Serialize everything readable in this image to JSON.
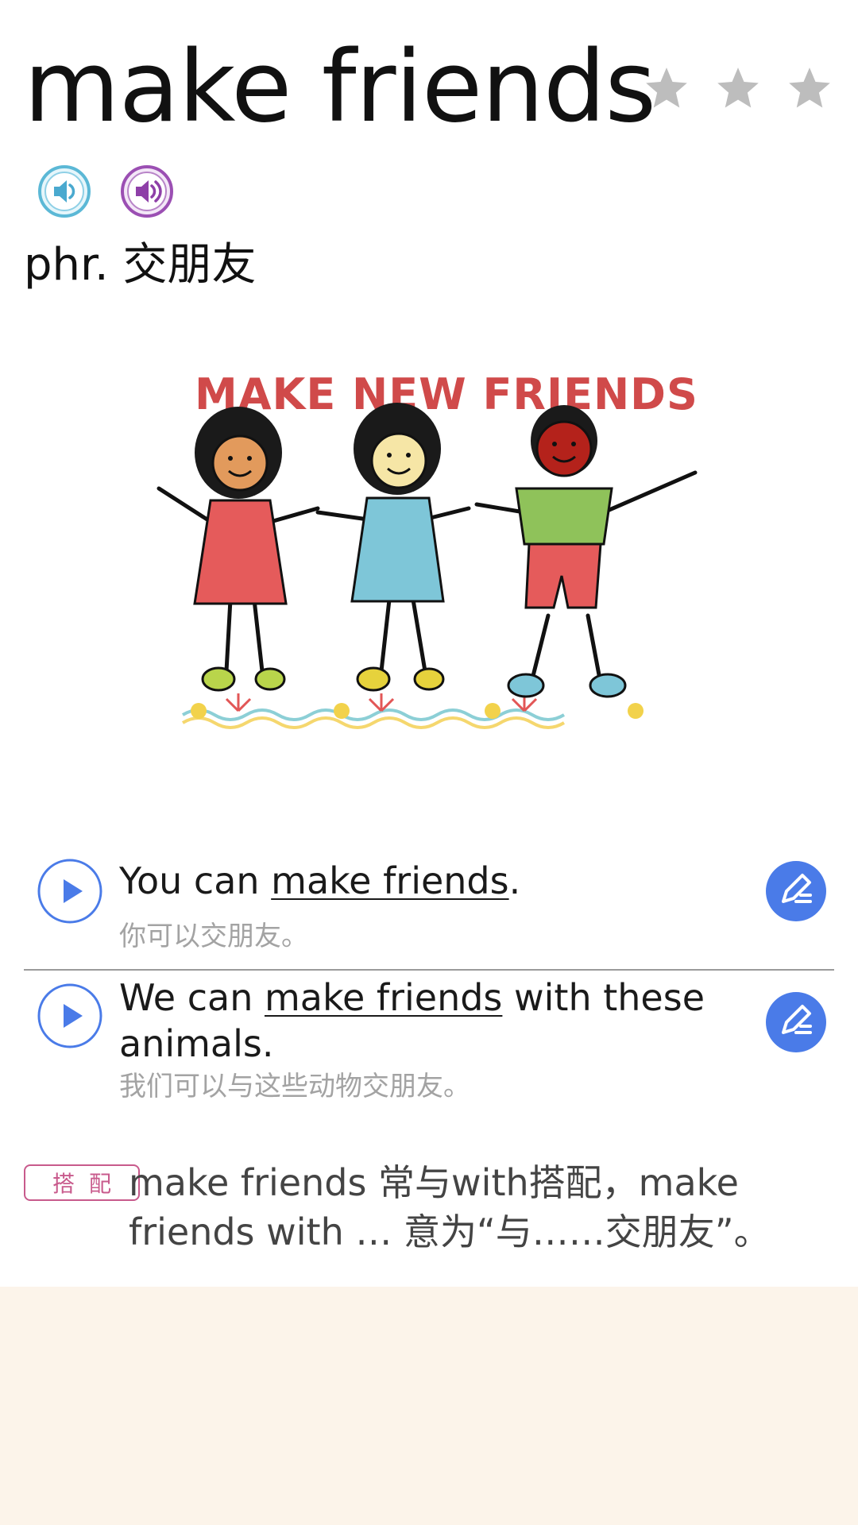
{
  "word": {
    "title": "make friends",
    "rating_max": 3,
    "rating": 0,
    "part_of_speech": "phr.",
    "meaning": "交朋友"
  },
  "audio": {
    "uk_icon": "speaker-icon-blue",
    "us_icon": "speaker-icon-purple"
  },
  "illustration": {
    "caption": "MAKE NEW FRIENDS"
  },
  "examples": [
    {
      "before": "You can ",
      "highlight": "make friends",
      "after": ".",
      "translation": "你可以交朋友。"
    },
    {
      "before": "We can ",
      "highlight": "make friends",
      "after": " with these animals.",
      "translation": "我们可以与这些动物交朋友。"
    }
  ],
  "collocation": {
    "tag": "搭配",
    "text": "make friends 常与with搭配，make friends with … 意为“与……交朋友”。"
  },
  "colors": {
    "accent_blue": "#4a7be8",
    "star_gray": "#bdbdbd",
    "tag_pink": "#c85a8c",
    "footer_bg": "#fcf4ea"
  }
}
